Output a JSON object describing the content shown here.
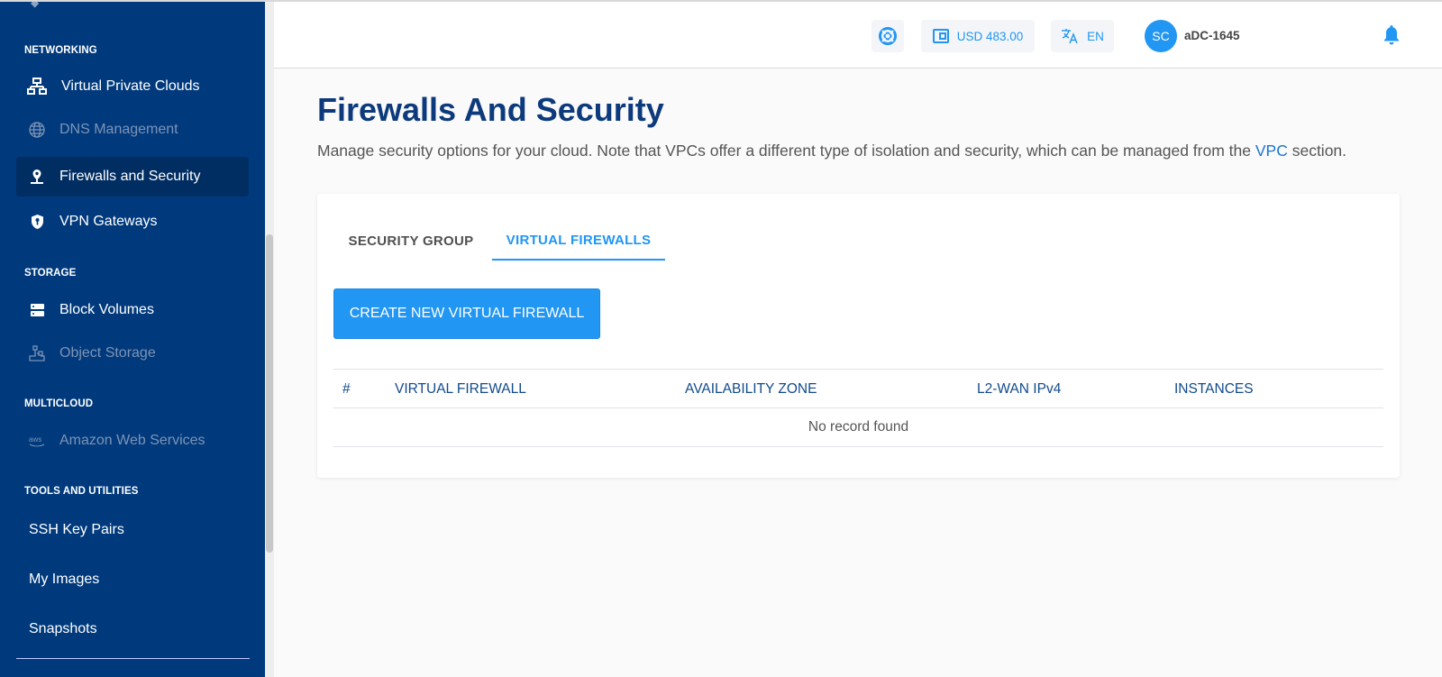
{
  "sidebar": {
    "sections": [
      {
        "label": "NETWORKING"
      },
      {
        "label": "STORAGE"
      },
      {
        "label": "MULTICLOUD"
      },
      {
        "label": "TOOLS AND UTILITIES"
      }
    ],
    "items": [
      {
        "label": "Virtual Private Clouds",
        "icon": "network-icon",
        "state": "enabled"
      },
      {
        "label": "DNS Management",
        "icon": "globe-icon",
        "state": "disabled"
      },
      {
        "label": "Firewalls and Security",
        "icon": "location-pin-icon",
        "state": "active"
      },
      {
        "label": "VPN Gateways",
        "icon": "shield-key-icon",
        "state": "enabled"
      },
      {
        "label": "Block Volumes",
        "icon": "storage-icon",
        "state": "enabled"
      },
      {
        "label": "Object Storage",
        "icon": "object-storage-icon",
        "state": "disabled"
      },
      {
        "label": "Amazon Web Services",
        "icon": "aws-icon",
        "state": "disabled"
      },
      {
        "label": "SSH Key Pairs",
        "state": "enabled"
      },
      {
        "label": "My Images",
        "state": "enabled"
      },
      {
        "label": "Snapshots",
        "state": "enabled"
      }
    ]
  },
  "header": {
    "help_icon": "lifebuoy-icon",
    "balance": "USD 483.00",
    "language": "EN",
    "avatar_initials": "SC",
    "username": "aDC-1645",
    "notifications_icon": "bell-icon"
  },
  "main": {
    "title": "Firewalls And Security",
    "description_before": "Manage security options for your cloud. Note that VPCs offer a different type of isolation and security, which can be managed from the ",
    "description_link": "VPC",
    "description_after": " section.",
    "tabs": [
      {
        "label": "SECURITY GROUP",
        "active": false
      },
      {
        "label": "VIRTUAL FIREWALLS",
        "active": true
      }
    ],
    "create_button": "CREATE NEW VIRTUAL FIREWALL",
    "table": {
      "columns": [
        "#",
        "VIRTUAL FIREWALL",
        "AVAILABILITY ZONE",
        "L2-WAN IPv4",
        "INSTANCES"
      ],
      "rows": [],
      "empty_text": "No record found"
    }
  },
  "colors": {
    "sidebar_bg": "#003a7c",
    "sidebar_active_bg": "#002d62",
    "accent": "#2196f3",
    "title": "#0c3a7c",
    "link": "#1976d2"
  }
}
